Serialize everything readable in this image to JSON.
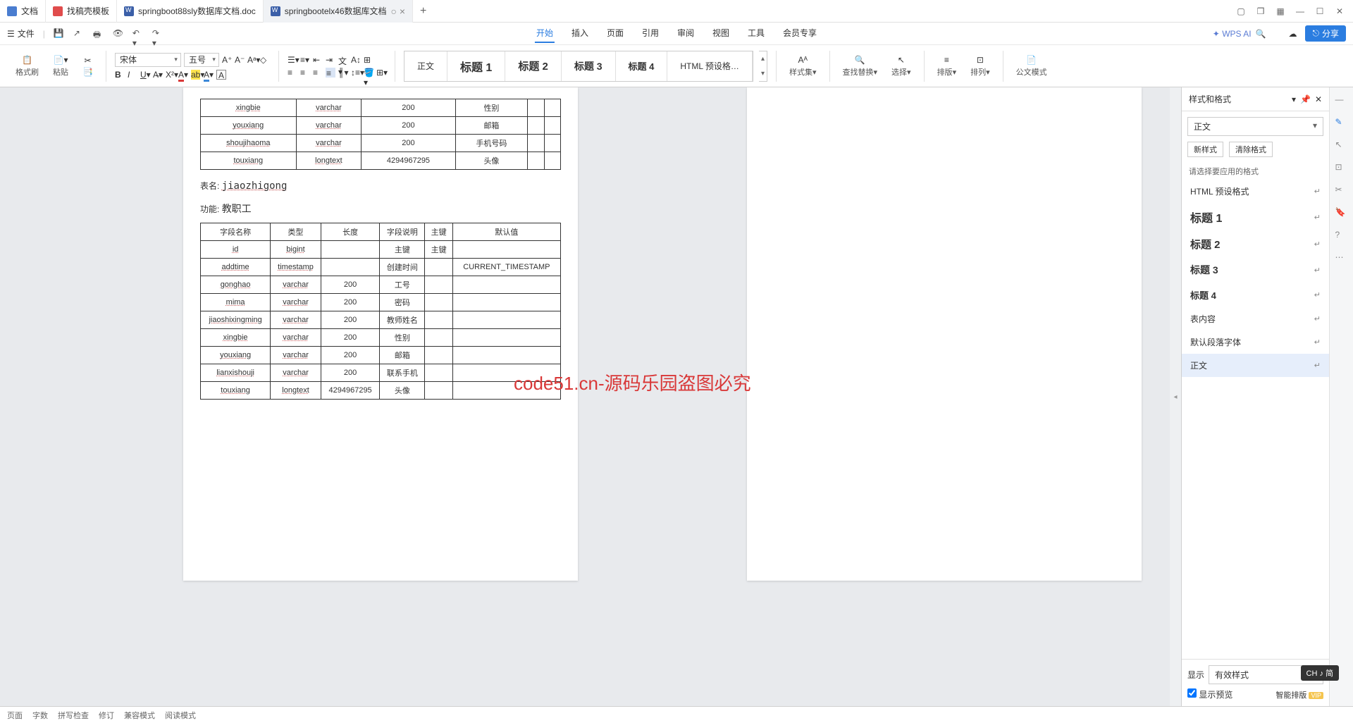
{
  "tabs": [
    {
      "label": "文档",
      "icon": "doc-icon-blue"
    },
    {
      "label": "找稿壳模板",
      "icon": "doc-icon-red"
    },
    {
      "label": "springboot88sly数据库文档.doc",
      "icon": "doc-icon-w"
    },
    {
      "label": "springbootelx46数据库文档",
      "icon": "doc-icon-w",
      "active": true
    }
  ],
  "menuFile": "文件",
  "ribbonTabs": [
    "开始",
    "插入",
    "页面",
    "引用",
    "审阅",
    "视图",
    "工具",
    "会员专享"
  ],
  "wpsAi": "WPS AI",
  "shareLabel": "分享",
  "format": {
    "brush": "格式刷",
    "paste": "粘贴"
  },
  "fontName": "宋体",
  "fontSize": "五号",
  "styles": [
    "正文",
    "标题 1",
    "标题 2",
    "标题 3",
    "标题 4",
    "HTML 预设格…"
  ],
  "rightTools": {
    "styleSet": "样式集",
    "findReplace": "查找替换",
    "select": "选择",
    "sort": "排版",
    "arrange": "排列",
    "official": "公文模式"
  },
  "panel": {
    "title": "样式和格式",
    "input": "正文",
    "newStyle": "新样式",
    "clear": "清除格式",
    "hint": "请选择要应用的格式",
    "items": [
      {
        "t": "HTML 预设格式",
        "s": ""
      },
      {
        "t": "标题 1",
        "s": "font-size:16px;font-weight:bold"
      },
      {
        "t": "标题 2",
        "s": "font-size:15px;font-weight:bold"
      },
      {
        "t": "标题 3",
        "s": "font-size:14px;font-weight:bold"
      },
      {
        "t": "标题 4",
        "s": "font-size:13px;font-weight:bold"
      },
      {
        "t": "表内容",
        "s": ""
      },
      {
        "t": "默认段落字体",
        "s": ""
      },
      {
        "t": "正文",
        "s": "",
        "sel": true
      }
    ],
    "showLabel": "显示",
    "showValue": "有效样式",
    "preview": "显示预览",
    "smart": "智能排版"
  },
  "watermark": "code51.cn-源码乐园盗图必究",
  "t1": {
    "rows": [
      [
        "xingbie",
        "varchar",
        "200",
        "性别",
        "",
        ""
      ],
      [
        "youxiang",
        "varchar",
        "200",
        "邮箱",
        "",
        ""
      ],
      [
        "shoujihaoma",
        "varchar",
        "200",
        "手机号码",
        "",
        ""
      ],
      [
        "touxiang",
        "longtext",
        "4294967295",
        "头像",
        "",
        ""
      ]
    ]
  },
  "t2": {
    "nameLabel": "表名:",
    "name": "jiaozhigong",
    "fnLabel": "功能:",
    "fn": "教职工",
    "headers": [
      "字段名称",
      "类型",
      "长度",
      "字段说明",
      "主键",
      "默认值"
    ],
    "rows": [
      [
        "id",
        "bigint",
        "",
        "主键",
        "主键",
        ""
      ],
      [
        "addtime",
        "timestamp",
        "",
        "创建时间",
        "",
        "CURRENT_TIMESTAMP"
      ],
      [
        "gonghao",
        "varchar",
        "200",
        "工号",
        "",
        ""
      ],
      [
        "mima",
        "varchar",
        "200",
        "密码",
        "",
        ""
      ],
      [
        "jiaoshixingming",
        "varchar",
        "200",
        "教师姓名",
        "",
        ""
      ],
      [
        "xingbie",
        "varchar",
        "200",
        "性别",
        "",
        ""
      ],
      [
        "youxiang",
        "varchar",
        "200",
        "邮箱",
        "",
        ""
      ],
      [
        "lianxishouji",
        "varchar",
        "200",
        "联系手机",
        "",
        ""
      ],
      [
        "touxiang",
        "longtext",
        "4294967295",
        "头像",
        "",
        ""
      ]
    ]
  },
  "chBadge": "CH ♪ 简",
  "status": {
    "page": "页面",
    "words": "字数",
    "spell": "拼写检查",
    "track": "修订",
    "compat": "兼容模式",
    "read": "阅读模式"
  }
}
